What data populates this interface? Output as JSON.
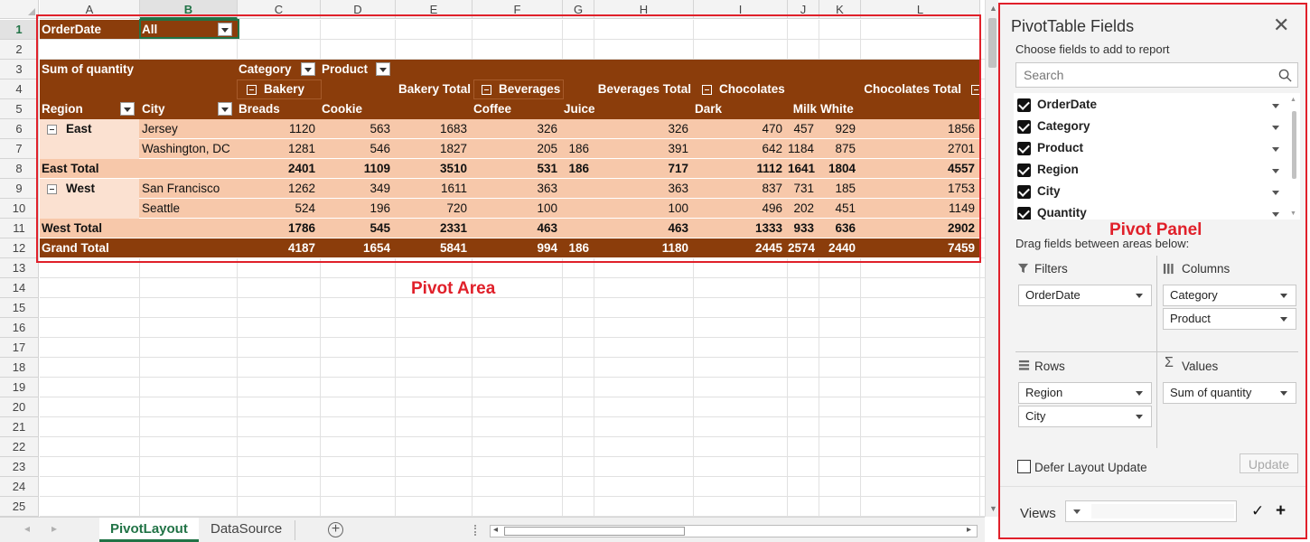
{
  "sheet": {
    "columns": [
      "A",
      "B",
      "C",
      "D",
      "E",
      "F",
      "G",
      "H",
      "I",
      "J",
      "K",
      "L"
    ],
    "rows": [
      "1",
      "2",
      "3",
      "4",
      "5",
      "6",
      "7",
      "8",
      "9",
      "10",
      "11",
      "12",
      "13",
      "14",
      "15",
      "16",
      "17",
      "18",
      "19",
      "20",
      "21",
      "22",
      "23",
      "24",
      "25"
    ],
    "selected_column": "B",
    "selected_row": "1"
  },
  "pivot": {
    "filter_label": "OrderDate",
    "filter_value": "All",
    "sum_label": "Sum of quantity",
    "category_label": "Category",
    "product_label": "Product",
    "bakery": "Bakery",
    "bakery_total": "Bakery Total",
    "beverages": "Beverages",
    "beverages_total": "Beverages Total",
    "chocolates": "Chocolates",
    "chocolates_total": "Chocolates Total",
    "region_label": "Region",
    "city_label": "City",
    "col_headers": [
      "Breads",
      "Cookie",
      "",
      "Coffee",
      "Juice",
      "",
      "Dark",
      "Milk",
      "White",
      "",
      "Ch"
    ],
    "rows": [
      {
        "region": "East",
        "city": "Jersey",
        "vals": [
          "1120",
          "563",
          "1683",
          "326",
          "",
          "326",
          "470",
          "457",
          "929",
          "1856"
        ]
      },
      {
        "region": "",
        "city": "Washington, DC",
        "vals": [
          "1281",
          "546",
          "1827",
          "205",
          "186",
          "391",
          "642",
          "1184",
          "875",
          "2701"
        ]
      },
      {
        "region": "East Total",
        "city": "",
        "vals": [
          "2401",
          "1109",
          "3510",
          "531",
          "186",
          "717",
          "1112",
          "1641",
          "1804",
          "4557"
        ],
        "bold": true
      },
      {
        "region": "West",
        "city": "San Francisco",
        "vals": [
          "1262",
          "349",
          "1611",
          "363",
          "",
          "363",
          "837",
          "731",
          "185",
          "1753"
        ]
      },
      {
        "region": "",
        "city": "Seattle",
        "vals": [
          "524",
          "196",
          "720",
          "100",
          "",
          "100",
          "496",
          "202",
          "451",
          "1149"
        ]
      },
      {
        "region": "West Total",
        "city": "",
        "vals": [
          "1786",
          "545",
          "2331",
          "463",
          "",
          "463",
          "1333",
          "933",
          "636",
          "2902"
        ],
        "bold": true
      },
      {
        "region": "Grand Total",
        "city": "",
        "vals": [
          "4187",
          "1654",
          "5841",
          "994",
          "186",
          "1180",
          "2445",
          "2574",
          "2440",
          "7459"
        ],
        "bold": true
      }
    ]
  },
  "annotations": {
    "pivot_area": "Pivot Area",
    "pivot_panel": "Pivot Panel"
  },
  "tabs": {
    "items": [
      "PivotLayout",
      "DataSource"
    ],
    "active": "PivotLayout"
  },
  "panel": {
    "title": "PivotTable Fields",
    "subtitle": "Choose fields to add to report",
    "search_placeholder": "Search",
    "fields": [
      "OrderDate",
      "Category",
      "Product",
      "Region",
      "City",
      "Quantity"
    ],
    "drag_label": "Drag fields between areas below:",
    "filters_label": "Filters",
    "columns_label": "Columns",
    "rows_label": "Rows",
    "values_label": "Values",
    "filters": [
      "OrderDate"
    ],
    "columns": [
      "Category",
      "Product"
    ],
    "rows": [
      "Region",
      "City"
    ],
    "values": [
      "Sum of quantity"
    ],
    "defer_label": "Defer Layout Update",
    "update_label": "Update",
    "views_label": "Views"
  },
  "colors": {
    "pivot_header": "#8b3d0b",
    "pivot_body": "#f7c8aa",
    "pivot_band": "#fbe1d1",
    "accent": "#217346",
    "annotation": "#e0202a"
  }
}
